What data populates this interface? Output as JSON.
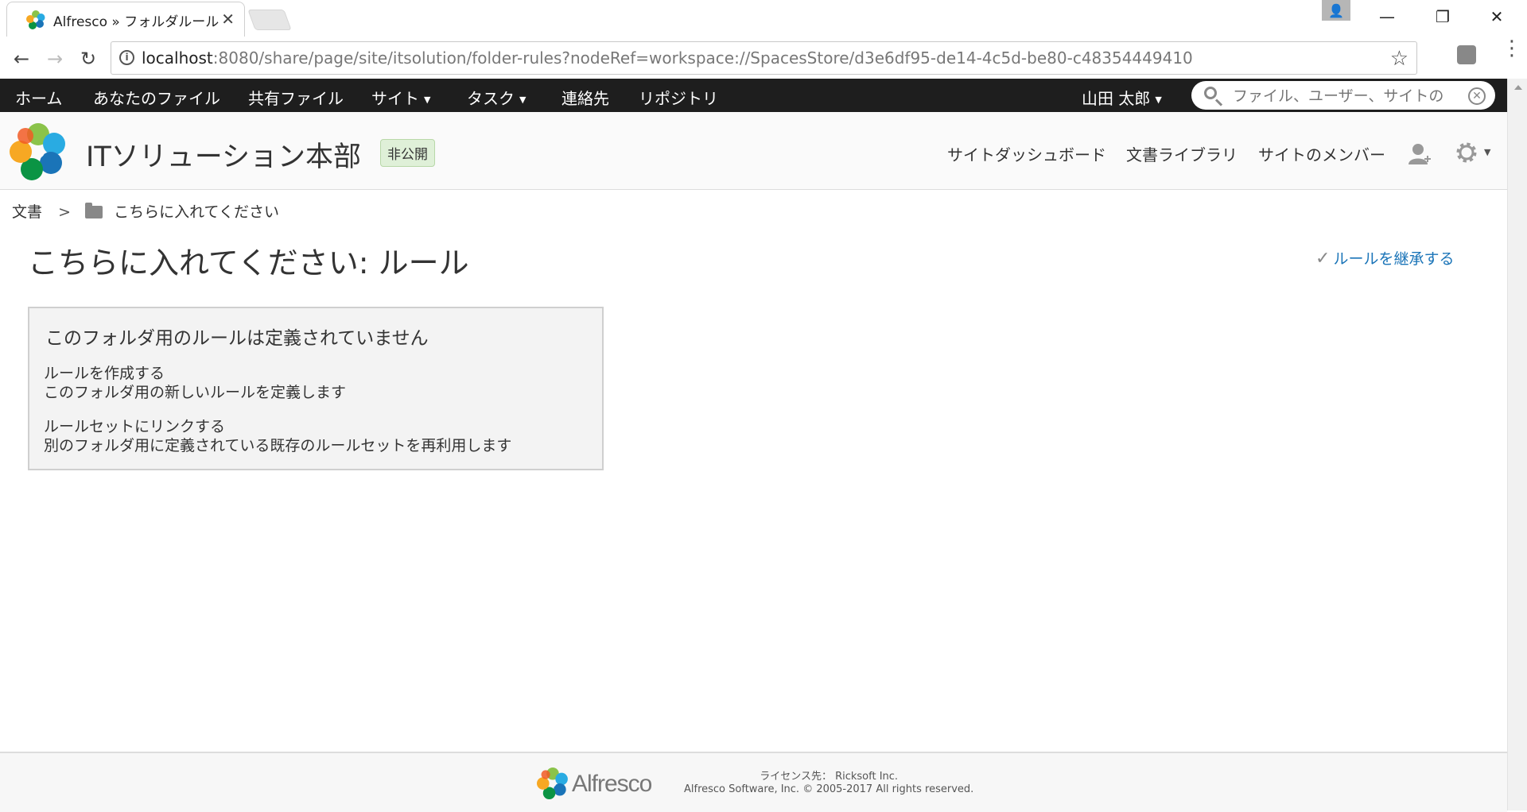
{
  "browser": {
    "tab_title": "Alfresco » フォルダルール",
    "url_host": "localhost",
    "url_path": ":8080/share/page/site/itsolution/folder-rules?nodeRef=workspace://SpacesStore/d3e6df95-de14-4c5d-be80-c48354449410"
  },
  "app_nav": {
    "items": [
      "ホーム",
      "あなたのファイル",
      "共有ファイル",
      "サイト",
      "タスク",
      "連絡先",
      "リポジトリ"
    ],
    "user": "山田 太郎",
    "search_placeholder": "ファイル、ユーザー、サイトの"
  },
  "site": {
    "title": "ITソリューション本部",
    "visibility": "非公開",
    "nav": [
      "サイトダッシュボード",
      "文書ライブラリ",
      "サイトのメンバー"
    ]
  },
  "breadcrumb": {
    "root": "文書",
    "separator": ">",
    "folder": "こちらに入れてください"
  },
  "page": {
    "title": "こちらに入れてください: ルール",
    "inherit_rules": "ルールを継承する"
  },
  "rules_panel": {
    "heading": "このフォルダ用のルールは定義されていません",
    "create_rule": "ルールを作成する",
    "create_rule_desc": "このフォルダ用の新しいルールを定義します",
    "link_ruleset": "ルールセットにリンクする",
    "link_ruleset_desc": "別のフォルダ用に定義されている既存のルールセットを再利用します"
  },
  "footer": {
    "brand": "Alfresco",
    "license": "ライセンス先： Ricksoft Inc.",
    "copyright": "Alfresco Software, Inc. © 2005-2017 All rights reserved."
  },
  "icons": {
    "logo_colors": [
      "#8bc34a",
      "#0b9444",
      "#1a74b8",
      "#29abe2",
      "#f7a823",
      "#f15a24"
    ],
    "accent": "#1a74b8",
    "header_bg": "#1e1e1e"
  }
}
